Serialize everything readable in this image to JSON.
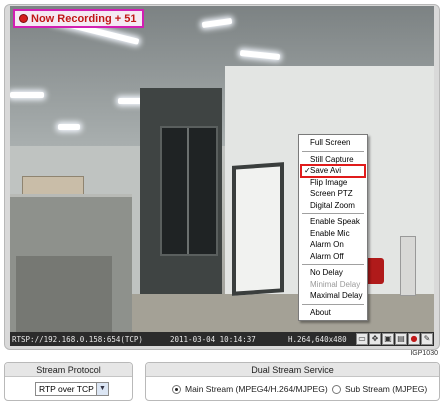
{
  "overlay": {
    "recording_label": "Now Recording + 51"
  },
  "context_menu": {
    "groups": [
      [
        {
          "label": "Full Screen"
        }
      ],
      [
        {
          "label": "Still Capture"
        },
        {
          "label": "Save Avi",
          "checked": true,
          "highlighted": true
        },
        {
          "label": "Flip Image"
        },
        {
          "label": "Screen PTZ"
        },
        {
          "label": "Digital Zoom"
        }
      ],
      [
        {
          "label": "Enable Speak"
        },
        {
          "label": "Enable Mic"
        },
        {
          "label": "Alarm On"
        },
        {
          "label": "Alarm Off"
        }
      ],
      [
        {
          "label": "No Delay"
        },
        {
          "label": "Minimal Delay",
          "disabled": true
        },
        {
          "label": "Maximal Delay"
        }
      ],
      [
        {
          "label": "About"
        }
      ]
    ],
    "check_mark": "✓"
  },
  "status_bar": {
    "url": "RTSP://192.168.0.158:654(TCP)",
    "timestamp": "2011-03-04 10:14:37",
    "codec": "H.264,640x480",
    "tools": [
      {
        "icon": "fit-screen-icon",
        "glyph": "▭"
      },
      {
        "icon": "ptz-move-icon",
        "glyph": "✥"
      },
      {
        "icon": "zoom-icon",
        "glyph": "▣"
      },
      {
        "icon": "snapshot-icon",
        "glyph": "▤"
      },
      {
        "icon": "record-icon",
        "glyph": "●"
      },
      {
        "icon": "settings-icon",
        "glyph": "✎"
      }
    ]
  },
  "model_label": "IGP1030",
  "stream_protocol": {
    "title": "Stream Protocol",
    "selected": "RTP over TCP"
  },
  "dual_stream": {
    "title": "Dual Stream Service",
    "options": [
      {
        "label": "Main Stream (MPEG4/H.264/MJPEG)",
        "selected": true
      },
      {
        "label": "Sub Stream (MJPEG)",
        "selected": false
      }
    ]
  },
  "colors": {
    "recording_border": "#d21fb3",
    "recording_text": "#c01818",
    "menu_highlight": "#e01b1b"
  }
}
